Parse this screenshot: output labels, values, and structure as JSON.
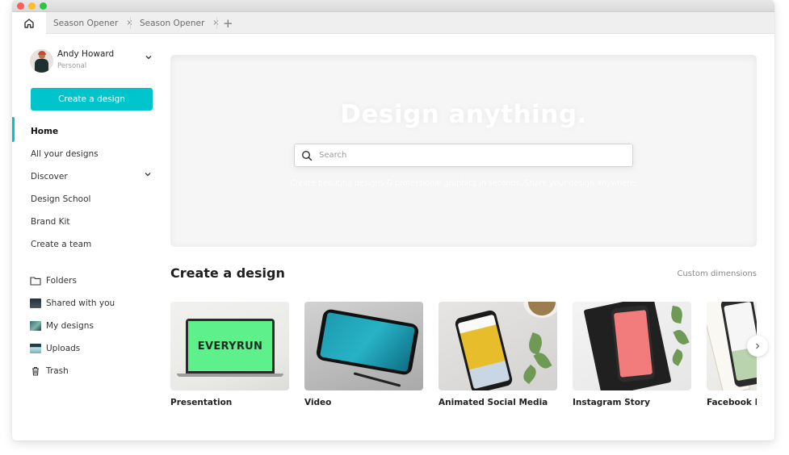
{
  "window": {
    "traffic_lights": [
      "close",
      "minimize",
      "zoom"
    ]
  },
  "tabs": {
    "home_icon": "home-icon",
    "items": [
      {
        "label": "Season Opener",
        "close": "×"
      },
      {
        "label": "Season Opener",
        "close": "×"
      }
    ],
    "new_tab": "+"
  },
  "sidebar": {
    "account": {
      "name": "Andy Howard",
      "type": "Personal"
    },
    "create_button": "Create a design",
    "nav": [
      {
        "label": "Home",
        "active": true
      },
      {
        "label": "All your designs"
      },
      {
        "label": "Discover",
        "expandable": true
      },
      {
        "label": "Design School"
      },
      {
        "label": "Brand Kit"
      },
      {
        "label": "Create a team"
      }
    ],
    "library": [
      {
        "label": "Folders",
        "icon": "folder-icon"
      },
      {
        "label": "Shared with you",
        "icon": "shared-thumbnail-icon"
      },
      {
        "label": "My designs",
        "icon": "my-designs-thumbnail-icon"
      },
      {
        "label": "Uploads",
        "icon": "uploads-thumbnail-icon"
      },
      {
        "label": "Trash",
        "icon": "trash-icon"
      }
    ]
  },
  "hero": {
    "title": "Design anything.",
    "search_placeholder": "Search",
    "search_value": "",
    "subtitle": "Create beautiful designs & professional graphics in seconds. Share your design anywhere."
  },
  "create_section": {
    "title": "Create a design",
    "custom_dimensions": "Custom dimensions",
    "cards": [
      {
        "label": "Presentation",
        "art_text": "EVERYRUN"
      },
      {
        "label": "Video"
      },
      {
        "label": "Animated Social Media"
      },
      {
        "label": "Instagram Story"
      },
      {
        "label": "Facebook Post"
      }
    ],
    "next_icon": "chevron-right-icon"
  },
  "colors": {
    "accent": "#00c4cc",
    "text_primary": "#222222",
    "text_muted": "#8a8a8a"
  }
}
